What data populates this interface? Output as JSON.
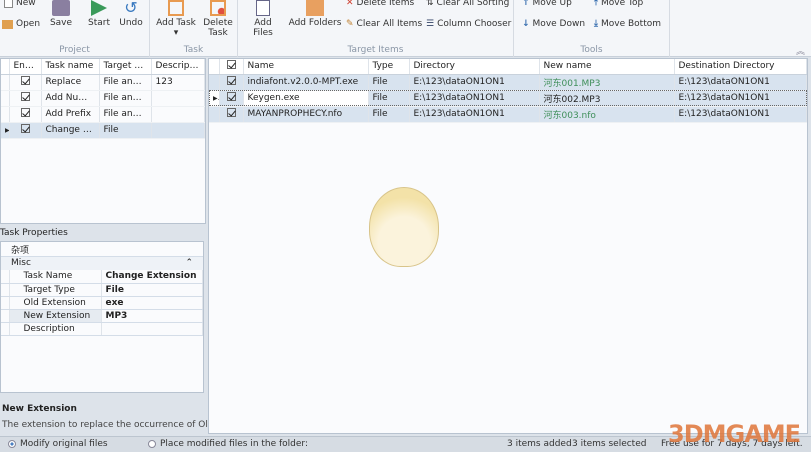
{
  "ribbon": {
    "project": {
      "label": "Project",
      "new": "New",
      "open": "Open",
      "save": "Save",
      "start": "Start",
      "undo": "Undo"
    },
    "task": {
      "label": "Task",
      "add_task": "Add Task",
      "delete_task": "Delete Task"
    },
    "target_items": {
      "label": "Target Items",
      "add_files": "Add Files",
      "add_folders": "Add Folders",
      "delete_items": "Delete Items",
      "clear_all_items": "Clear All Items",
      "clear_all_sorting": "Clear All Sorting",
      "column_chooser": "Column Chooser"
    },
    "tools": {
      "label": "Tools",
      "move_up": "Move Up",
      "move_down": "Move Down",
      "move_top": "Move Top",
      "move_bottom": "Move Bottom"
    }
  },
  "tasks": {
    "columns": [
      "Ena...",
      "Task name",
      "Target ty...",
      "Description"
    ],
    "rows": [
      {
        "name": "Replace",
        "target": "File and F...",
        "desc": "123"
      },
      {
        "name": "Add Nume...",
        "target": "File and F...",
        "desc": ""
      },
      {
        "name": "Add Prefix",
        "target": "File and F...",
        "desc": ""
      },
      {
        "name": "Change Ex...",
        "target": "File",
        "desc": ""
      }
    ]
  },
  "properties": {
    "title": "Task Properties",
    "category_cn": "杂项",
    "category": "Misc",
    "rows": [
      {
        "key": "Task Name",
        "value": "Change Extension"
      },
      {
        "key": "Target Type",
        "value": "File"
      },
      {
        "key": "Old Extension",
        "value": "exe"
      },
      {
        "key": "New Extension",
        "value": "MP3"
      },
      {
        "key": "Description",
        "value": ""
      }
    ],
    "help_title": "New Extension",
    "help_text": "The extension to replace the occurrence of Ol..."
  },
  "files": {
    "columns": [
      "Name",
      "Type",
      "Directory",
      "New name",
      "Destination Directory"
    ],
    "rows": [
      {
        "name": "indiafont.v2.0.0-MPT.exe",
        "type": "File",
        "dir": "E:\\123\\dataON1ON1",
        "new": "河东001.MP3",
        "dest": "E:\\123\\dataON1ON1"
      },
      {
        "name": "Keygen.exe",
        "type": "File",
        "dir": "E:\\123\\dataON1ON1",
        "new": "河东002.MP3",
        "dest": "E:\\123\\dataON1ON1"
      },
      {
        "name": "MAYANPROPHECY.nfo",
        "type": "File",
        "dir": "E:\\123\\dataON1ON1",
        "new": "河东003.nfo",
        "dest": "E:\\123\\dataON1ON1"
      }
    ]
  },
  "status": {
    "modify_original": "Modify original files",
    "place_modified": "Place modified files in the folder:",
    "items_added": "3 items added",
    "items_selected": "3 items selected",
    "trial": "Free use for 7 days, 7 days left."
  },
  "watermark": "3DMGAME"
}
